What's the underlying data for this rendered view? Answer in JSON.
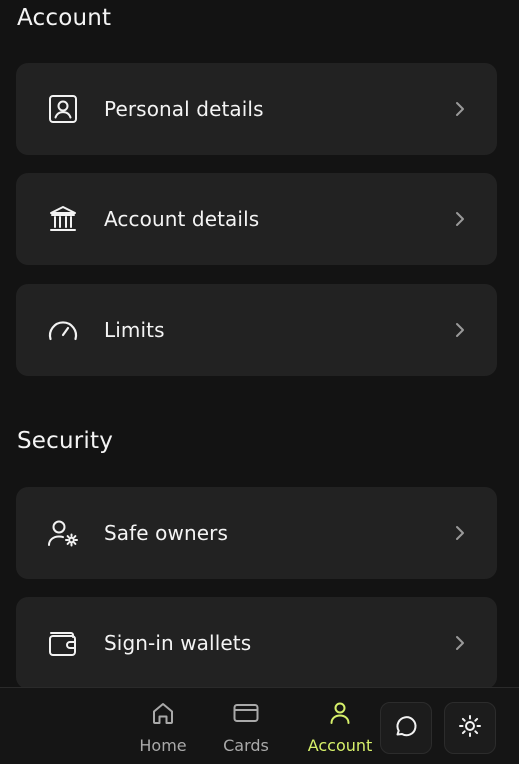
{
  "sections": {
    "account_title": "Account",
    "security_title": "Security"
  },
  "account_items": [
    {
      "label": "Personal details",
      "icon": "id-card-icon"
    },
    {
      "label": "Account details",
      "icon": "bank-icon"
    },
    {
      "label": "Limits",
      "icon": "gauge-icon"
    }
  ],
  "security_items": [
    {
      "label": "Safe owners",
      "icon": "user-settings-icon"
    },
    {
      "label": "Sign-in wallets",
      "icon": "wallet-icon"
    }
  ],
  "bottom_nav": {
    "home": "Home",
    "cards": "Cards",
    "account": "Account",
    "active": "Account"
  },
  "colors": {
    "background": "#131313",
    "card": "#222222",
    "accent": "#d6f06a",
    "muted": "#a9a9a9"
  }
}
